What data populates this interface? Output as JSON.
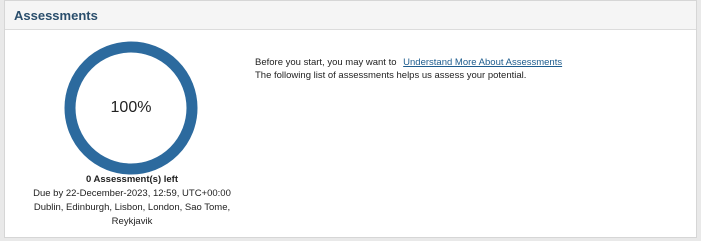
{
  "header": {
    "title": "Assessments"
  },
  "progress": {
    "percent_label": "100%",
    "fraction": 1.0,
    "ring_color": "#2c6a9e",
    "track_color": "#e3e9ef"
  },
  "summary": {
    "remaining": "0 Assessment(s) left",
    "due": "Due by 22-December-2023, 12:59, UTC+00:00",
    "timezone_line1": "Dublin, Edinburgh, Lisbon, London, Sao Tome,",
    "timezone_line2": "Reykjavik"
  },
  "intro": {
    "prefix": "Before you start, you may want to",
    "link_label": "Understand More About Assessments",
    "description": "The following list of assessments helps us assess your potential."
  },
  "colors": {
    "title": "#2a4e6c",
    "link": "#1d5c8e"
  }
}
